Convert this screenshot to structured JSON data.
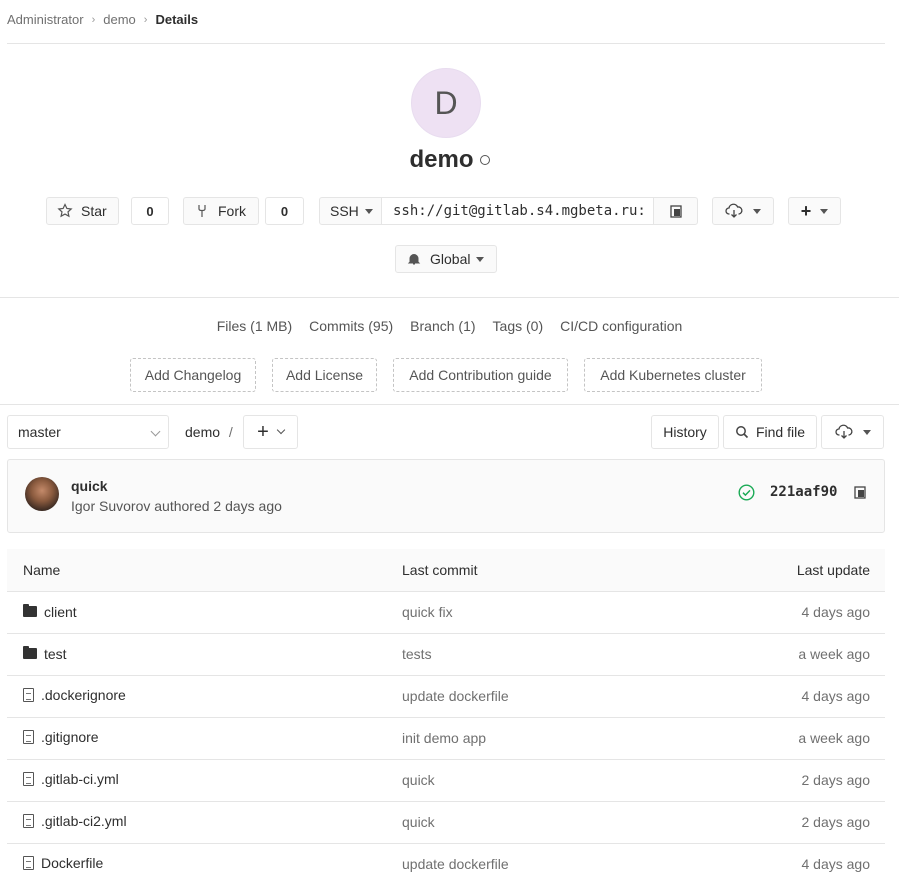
{
  "breadcrumb": {
    "items": [
      "Administrator",
      "demo"
    ],
    "current": "Details"
  },
  "project": {
    "avatar_letter": "D",
    "name": "demo"
  },
  "actions": {
    "star_label": "Star",
    "star_count": "0",
    "fork_label": "Fork",
    "fork_count": "0",
    "protocol": "SSH",
    "clone_url": "ssh://git@gitlab.s4.mgbeta.ru:",
    "notification": "Global"
  },
  "stats": [
    "Files (1 MB)",
    "Commits (95)",
    "Branch (1)",
    "Tags (0)",
    "CI/CD configuration"
  ],
  "add_buttons": [
    "Add Changelog",
    "Add License",
    "Add Contribution guide",
    "Add Kubernetes cluster"
  ],
  "tree": {
    "branch": "master",
    "path": "demo",
    "path_sep": "/",
    "history": "History",
    "find_file": "Find file"
  },
  "last_commit": {
    "title": "quick",
    "author_line": "Igor Suvorov authored 2 days ago",
    "sha": "221aaf90"
  },
  "files": {
    "headers": {
      "name": "Name",
      "commit": "Last commit",
      "date": "Last update"
    },
    "rows": [
      {
        "name": "client",
        "type": "folder",
        "commit": "quick fix",
        "date": "4 days ago"
      },
      {
        "name": "test",
        "type": "folder",
        "commit": "tests",
        "date": "a week ago"
      },
      {
        "name": ".dockerignore",
        "type": "file",
        "commit": "update dockerfile",
        "date": "4 days ago"
      },
      {
        "name": ".gitignore",
        "type": "file",
        "commit": "init demo app",
        "date": "a week ago"
      },
      {
        "name": ".gitlab-ci.yml",
        "type": "file",
        "commit": "quick",
        "date": "2 days ago"
      },
      {
        "name": ".gitlab-ci2.yml",
        "type": "file",
        "commit": "quick",
        "date": "2 days ago"
      },
      {
        "name": "Dockerfile",
        "type": "file",
        "commit": "update dockerfile",
        "date": "4 days ago"
      }
    ]
  },
  "colors": {
    "avatar_bg": "#eee1f3",
    "pipeline_success": "#1aaa55"
  }
}
